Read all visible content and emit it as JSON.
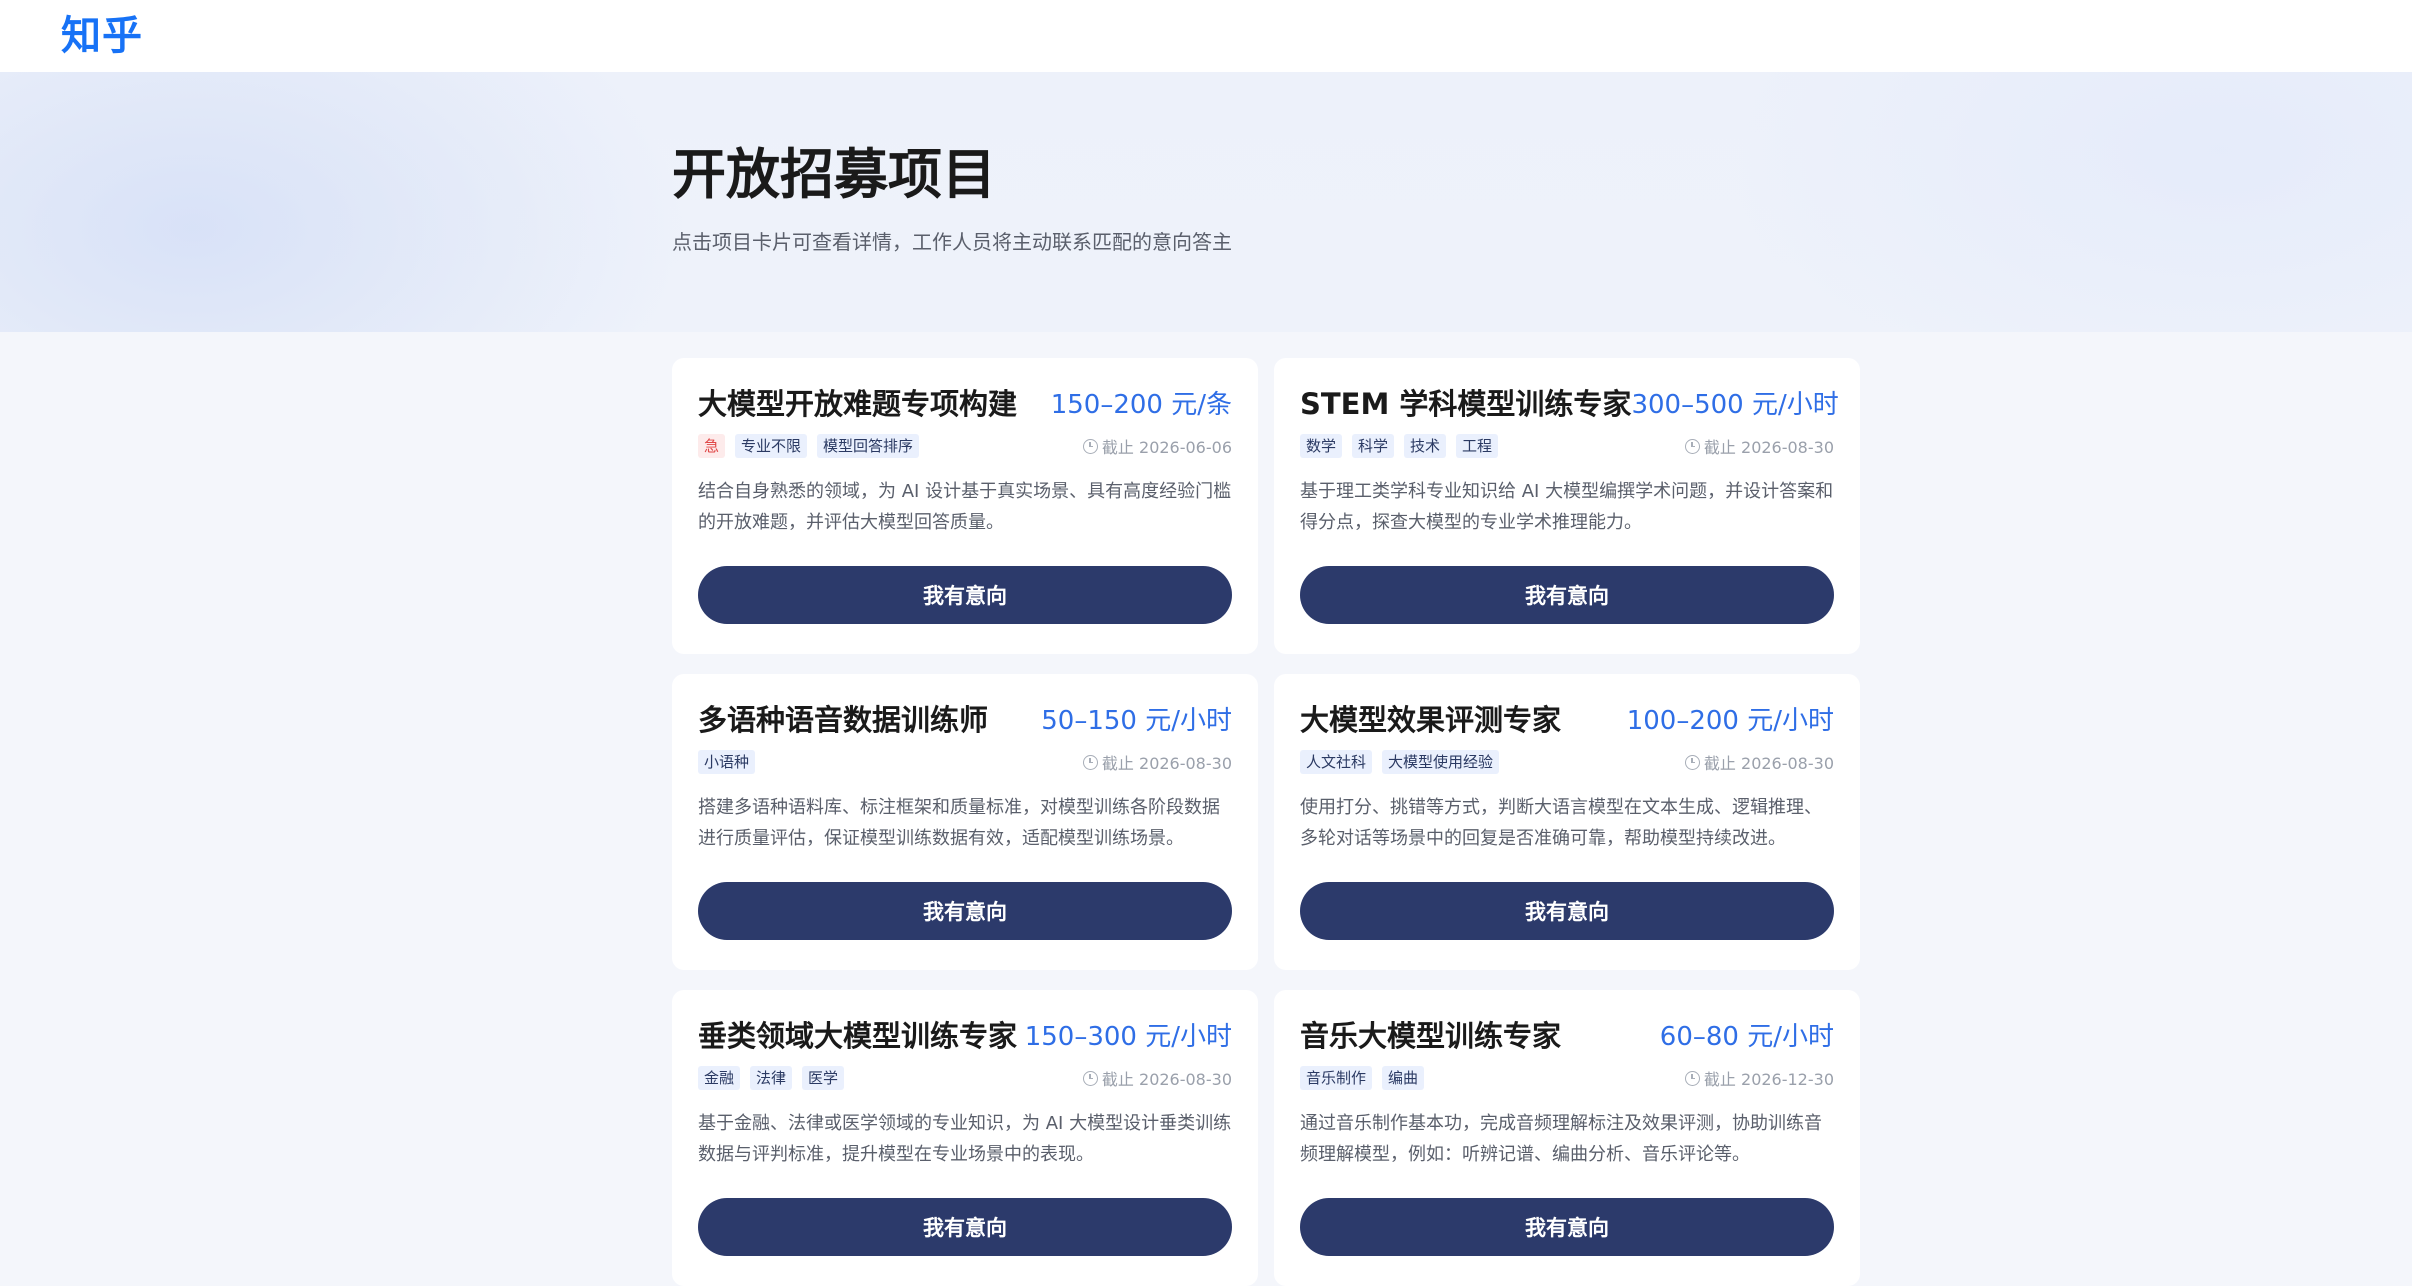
{
  "brand": {
    "logo_text": "知乎",
    "accent": "#1772f6"
  },
  "hero": {
    "title": "开放招募项目",
    "subtitle": "点击项目卡片可查看详情，工作人员将主动联系匹配的意向答主"
  },
  "projects": [
    {
      "title": "大模型开放难题专项构建",
      "price": "150–200 元/条",
      "urgent": "急",
      "tags": [
        "专业不限",
        "模型回答排序"
      ],
      "deadline": "截止 2026-06-06",
      "description": "结合自身熟悉的领域，为 AI 设计基于真实场景、具有高度经验门槛的开放难题，并评估大模型回答质量。",
      "cta": "我有意向"
    },
    {
      "title": "STEM 学科模型训练专家",
      "price": "300–500 元/小时",
      "tags": [
        "数学",
        "科学",
        "技术",
        "工程"
      ],
      "deadline": "截止 2026-08-30",
      "description": "基于理工类学科专业知识给 AI 大模型编撰学术问题，并设计答案和得分点，探查大模型的专业学术推理能力。",
      "cta": "我有意向"
    },
    {
      "title": "多语种语音数据训练师",
      "price": "50–150 元/小时",
      "tags": [
        "小语种"
      ],
      "deadline": "截止 2026-08-30",
      "description": "搭建多语种语料库、标注框架和质量标准，对模型训练各阶段数据进行质量评估，保证模型训练数据有效，适配模型训练场景。",
      "cta": "我有意向"
    },
    {
      "title": "大模型效果评测专家",
      "price": "100–200 元/小时",
      "tags": [
        "人文社科",
        "大模型使用经验"
      ],
      "deadline": "截止 2026-08-30",
      "description": "使用打分、挑错等方式，判断大语言模型在文本生成、逻辑推理、多轮对话等场景中的回复是否准确可靠，帮助模型持续改进。",
      "cta": "我有意向"
    },
    {
      "title": "垂类领域大模型训练专家",
      "price": "150–300 元/小时",
      "tags": [
        "金融",
        "法律",
        "医学"
      ],
      "deadline": "截止 2026-08-30",
      "description": "基于金融、法律或医学领域的专业知识，为 AI 大模型设计垂类训练数据与评判标准，提升模型在专业场景中的表现。",
      "cta": "我有意向"
    },
    {
      "title": "音乐大模型训练专家",
      "price": "60–80 元/小时",
      "tags": [
        "音乐制作",
        "编曲"
      ],
      "deadline": "截止 2026-12-30",
      "description": "通过音乐制作基本功，完成音频理解标注及效果评测，协助训练音频理解模型，例如：听辨记谱、编曲分析、音乐评论等。",
      "cta": "我有意向"
    }
  ]
}
